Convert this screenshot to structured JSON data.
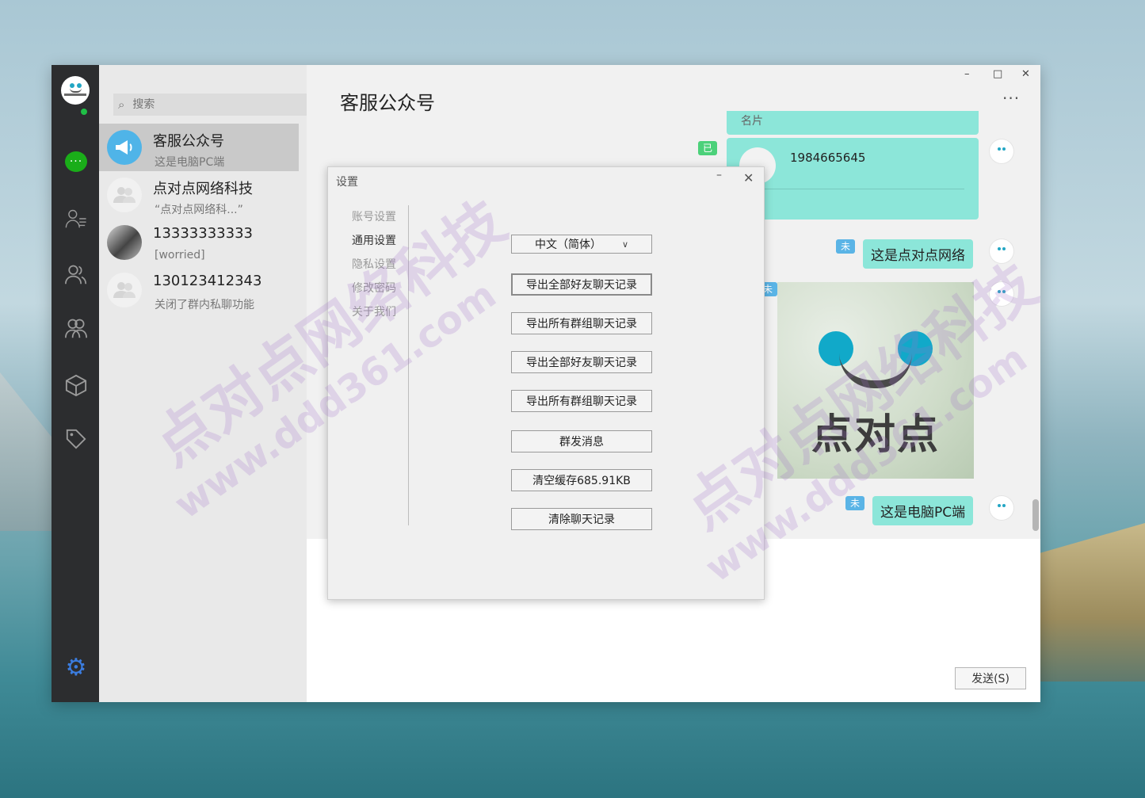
{
  "sidebar": {
    "items": [
      {
        "icon": "chat-icon",
        "active": true
      },
      {
        "icon": "contacts-icon"
      },
      {
        "icon": "friends-icon"
      },
      {
        "icon": "groups-icon"
      },
      {
        "icon": "box-icon"
      },
      {
        "icon": "tag-icon"
      }
    ],
    "settings_icon": "gear-icon"
  },
  "search": {
    "placeholder": "搜索"
  },
  "conversations": [
    {
      "name": "客服公众号",
      "preview": "这是电脑PC端",
      "avatar": "megaphone-avatar",
      "active": true
    },
    {
      "name": "点对点网络科技",
      "preview": "“点对点网络科...”",
      "avatar": "group-avatar"
    },
    {
      "name": "13333333333",
      "preview": "[worried]",
      "avatar": "photo-avatar"
    },
    {
      "name": "130123412343",
      "preview": "关闭了群内私聊功能",
      "avatar": "group-avatar"
    }
  ],
  "chat": {
    "title": "客服公众号",
    "more_label": "···",
    "window_controls": {
      "minimize": "–",
      "maximize": "□",
      "close": "✕"
    },
    "card": {
      "header": "名片",
      "number": "1984665645",
      "status_tag": "已"
    },
    "messages": [
      {
        "text": "这是点对点网络",
        "status_tag": "未"
      },
      {
        "text": "这是电脑PC端",
        "status_tag": "未"
      }
    ],
    "image": {
      "brand_text": "点对点",
      "status_tag": "未"
    },
    "send_label": "发送(S)"
  },
  "settings_dialog": {
    "title": "设置",
    "minimize": "–",
    "close": "✕",
    "nav": [
      "账号设置",
      "通用设置",
      "隐私设置",
      "修改密码",
      "关于我们"
    ],
    "active_nav": "通用设置",
    "language": "中文（简体）",
    "buttons": [
      "导出全部好友聊天记录",
      "导出所有群组聊天记录",
      "导出全部好友聊天记录",
      "导出所有群组聊天记录",
      "群发消息",
      "清空缓存685.91KB",
      "清除聊天记录"
    ]
  },
  "watermark": {
    "text_cn": "点对点网络科技",
    "text_url": "www.ddd361.com"
  },
  "colors": {
    "bubble": "#8ce6d9",
    "rail": "#2c2d2f",
    "accent_green": "#1aad19",
    "gear_blue": "#3b7de0"
  }
}
